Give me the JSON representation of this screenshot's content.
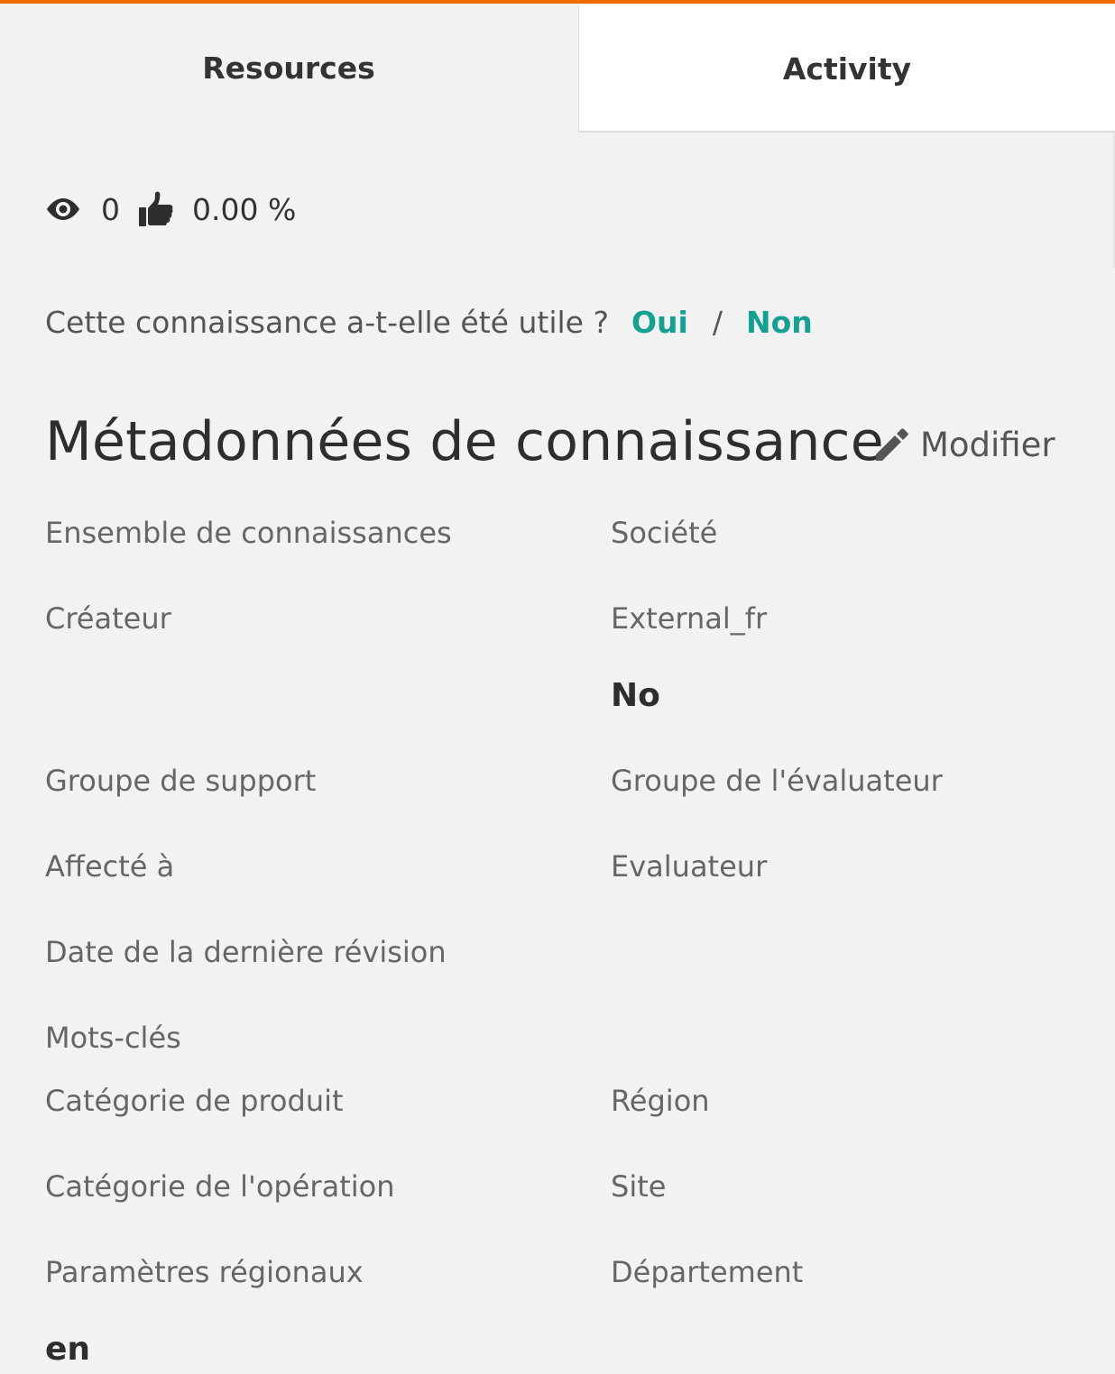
{
  "tabs": [
    {
      "label": "Resources",
      "active": false
    },
    {
      "label": "Activity",
      "active": true
    }
  ],
  "stats": {
    "views": "0",
    "rating": "0.00 %",
    "icons": [
      "eye-icon",
      "thumbs-up-icon"
    ]
  },
  "feedback": {
    "question": "Cette connaissance a-t-elle été utile ?",
    "yes": "Oui",
    "separator": "/",
    "no": "Non",
    "link_color": "#14a192"
  },
  "metadata": {
    "title": "Métadonnées de connaissance",
    "edit_label": "Modifier",
    "fields": {
      "knowledge_base": "Ensemble de connaissances",
      "company": "Société",
      "creator": "Créateur",
      "creator_value": "External_fr",
      "flag_value": "No",
      "support_group": "Groupe de support",
      "reviewer_group": "Groupe de l'évaluateur",
      "assigned_to": "Affecté à",
      "reviewer": "Evaluateur",
      "last_review_date": "Date de la dernière révision",
      "keywords": "Mots-clés",
      "product_category": "Catégorie de produit",
      "region": "Région",
      "operation_category": "Catégorie de l'opération",
      "site": "Site",
      "locale": "Paramètres régionaux",
      "locale_value": "en",
      "department": "Département"
    }
  },
  "colors": {
    "accent": "#f06c00",
    "background": "#f2f2f2"
  }
}
